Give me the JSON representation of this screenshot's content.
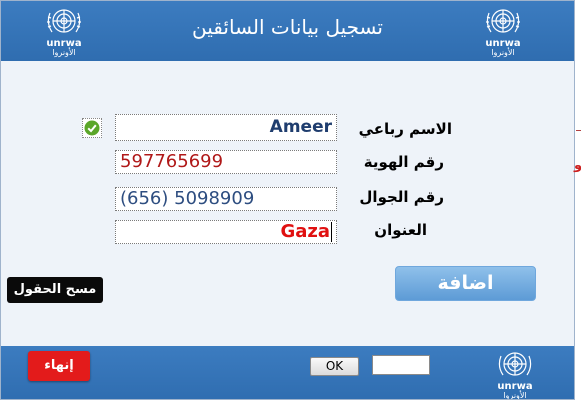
{
  "header": {
    "title": "تسجيل بيانات السائقين",
    "logo_text_en": "unrwa",
    "logo_text_ar": "الأونروا"
  },
  "form": {
    "name_label": "الاسم رباعي",
    "name_value": "Ameer",
    "id_label": "رقم الهوية",
    "id_value": "597765699",
    "mobile_label": "رقم الجوال",
    "mobile_value": "(656) 5098909",
    "address_label": "العنوان",
    "address_value": "Gaza"
  },
  "buttons": {
    "clear": "مسح الحقول",
    "add": "اضافة",
    "end": "إنهاء",
    "ok": "OK"
  },
  "colors": {
    "header_bg": "#3173b6",
    "add_button": "#6fa7dd",
    "end_button": "#e31b1b",
    "check_green": "#5aa629"
  }
}
